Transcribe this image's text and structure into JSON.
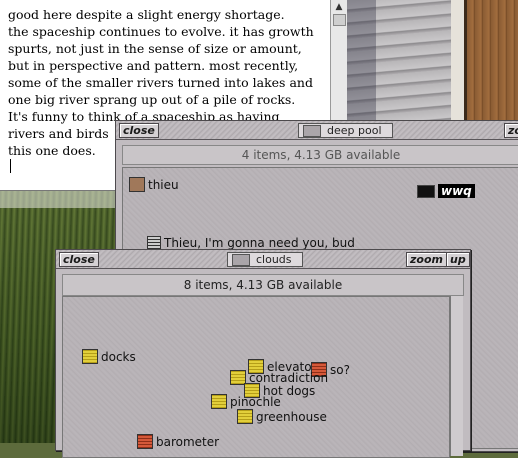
{
  "editor": {
    "lines": [
      "good here despite a slight energy shortage.",
      "the spaceship continues to evolve. it has growth",
      "spurts, not just in the sense of size or amount,",
      "but in perspective and pattern. most recently,",
      "some of the smaller rivers turned into lakes and",
      "one big river sprang up out of a pile of rocks.",
      "It's funny to think of a spaceship as having",
      "rivers and birds",
      "this one does."
    ]
  },
  "deep_pool": {
    "close_label": "close",
    "title": "deep pool",
    "zoom_label": "zo",
    "status": "4 items, 4.13 GB available",
    "items": [
      {
        "label": "thieu",
        "icon": "brown-folder-icon"
      },
      {
        "label": "wwq",
        "icon": "terminal-icon"
      },
      {
        "label": "Thieu, I'm gonna need you, bud",
        "icon": "document-icon"
      }
    ]
  },
  "clouds": {
    "close_label": "close",
    "title": "clouds",
    "zoom_label": "zoom",
    "up_label": "up",
    "status": "8 items, 4.13 GB available",
    "items": [
      {
        "label": "docks",
        "icon": "folder-icon"
      },
      {
        "label": "elevator",
        "icon": "folder-icon"
      },
      {
        "label": "so?",
        "icon": "red-folder-icon"
      },
      {
        "label": "contradiction",
        "icon": "folder-icon"
      },
      {
        "label": "hot dogs",
        "icon": "folder-icon"
      },
      {
        "label": "pinochle",
        "icon": "folder-icon"
      },
      {
        "label": "greenhouse",
        "icon": "folder-icon"
      },
      {
        "label": "barometer",
        "icon": "red-folder-icon"
      }
    ]
  }
}
